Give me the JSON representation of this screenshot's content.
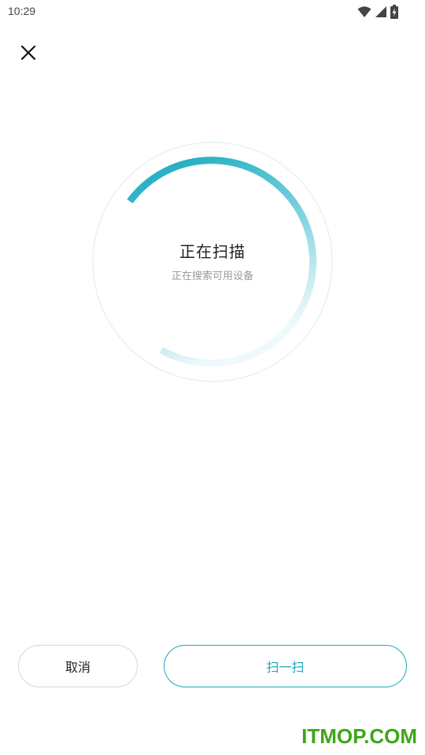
{
  "status_bar": {
    "time": "10:29",
    "icons": [
      "wifi-icon",
      "signal-icon",
      "battery-charging-icon"
    ]
  },
  "header": {
    "close_icon": "close-icon"
  },
  "scan": {
    "title": "正在扫描",
    "subtitle": "正在搜索可用设备",
    "accent_color": "#1aa9bd"
  },
  "actions": {
    "cancel_label": "取消",
    "scan_label": "扫一扫"
  },
  "watermark": {
    "text": "ITMOP.COM",
    "color": "#3fa51b"
  }
}
